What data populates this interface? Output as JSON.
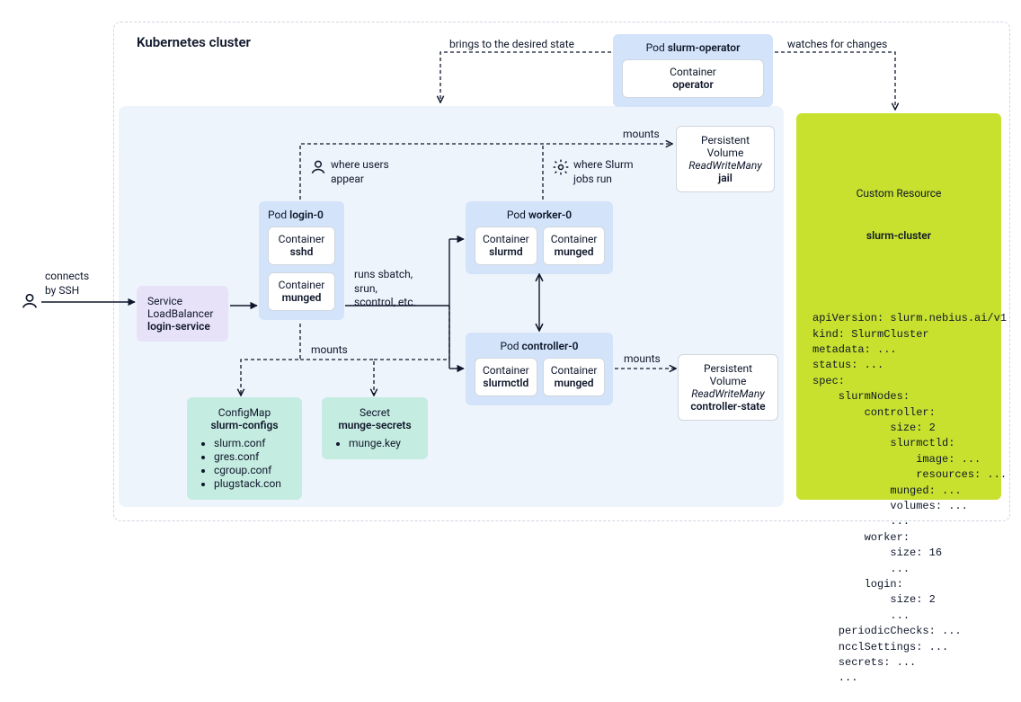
{
  "cluster_title": "Kubernetes cluster",
  "edge_labels": {
    "brings_state": "brings to the desired state",
    "watches": "watches for changes",
    "where_users": "where users\nappear",
    "where_jobs": "where Slurm\njobs run",
    "mounts_top": "mounts",
    "mounts_left": "mounts",
    "mounts_ctrl": "mounts",
    "connects_ssh": "connects\nby SSH",
    "runs_cmds": "runs sbatch,\nsrun,\nscontrol, etc."
  },
  "operator_pod": {
    "type": "Pod",
    "name": "slurm-operator",
    "container_type": "Container",
    "container_name": "operator"
  },
  "service": {
    "type": "Service",
    "kind": "LoadBalancer",
    "name": "login-service"
  },
  "login_pod": {
    "type": "Pod",
    "name": "login-0",
    "containers": [
      {
        "type": "Container",
        "name": "sshd"
      },
      {
        "type": "Container",
        "name": "munged"
      }
    ]
  },
  "worker_pod": {
    "type": "Pod",
    "name": "worker-0",
    "containers": [
      {
        "type": "Container",
        "name": "slurmd"
      },
      {
        "type": "Container",
        "name": "munged"
      }
    ]
  },
  "controller_pod": {
    "type": "Pod",
    "name": "controller-0",
    "containers": [
      {
        "type": "Container",
        "name": "slurmctld"
      },
      {
        "type": "Container",
        "name": "munged"
      }
    ]
  },
  "pv_jail": {
    "line1": "Persistent Volume",
    "line2": "ReadWriteMany",
    "name": "jail"
  },
  "pv_ctrl": {
    "line1": "Persistent Volume",
    "line2": "ReadWriteMany",
    "name": "controller-state"
  },
  "configmap": {
    "type": "ConfigMap",
    "name": "slurm-configs",
    "items": [
      "slurm.conf",
      "gres.conf",
      "cgroup.conf",
      "plugstack.con"
    ]
  },
  "secret": {
    "type": "Secret",
    "name": "munge-secrets",
    "items": [
      "munge.key"
    ]
  },
  "custom_resource": {
    "type": "Custom Resource",
    "name": "slurm-cluster",
    "yaml": "apiVersion: slurm.nebius.ai/v1\nkind: SlurmCluster\nmetadata: ...\nstatus: ...\nspec:\n    slurmNodes:\n        controller:\n            size: 2\n            slurmctld:\n                image: ...\n                resources: ...\n            munged: ...\n            volumes: ...\n            ...\n        worker:\n            size: 16\n            ...\n        login:\n            size: 2\n            ...\n    periodicChecks: ...\n    ncclSettings: ...\n    secrets: ...\n    ..."
  }
}
